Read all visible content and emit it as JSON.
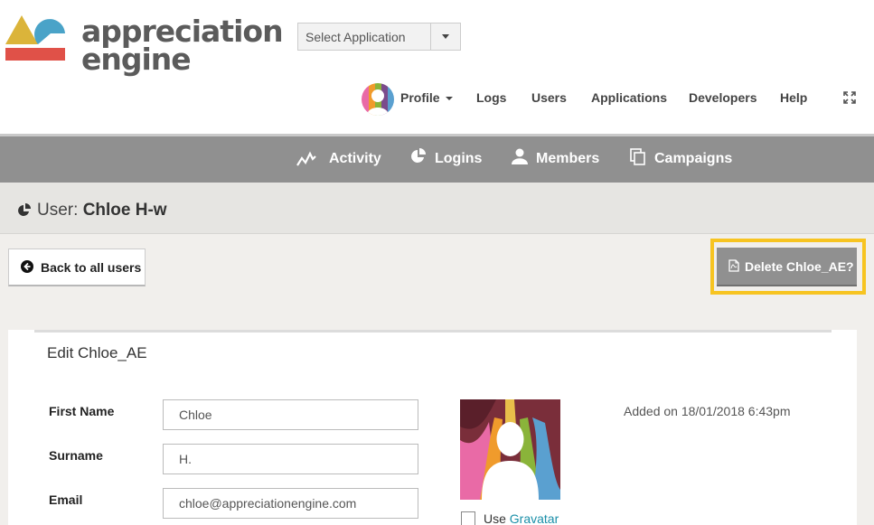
{
  "app": {
    "logo_line1": "appreciation",
    "logo_line2": "engine",
    "brand_colors": {
      "yellow": "#dbb43a",
      "blue": "#4aa3c8",
      "red": "#e05148",
      "grey": "#5b5b5b"
    }
  },
  "header": {
    "app_select": {
      "value": "Select Application"
    },
    "nav": [
      {
        "label": "Profile",
        "icon": "avatar"
      },
      {
        "label": "Logs"
      },
      {
        "label": "Users"
      },
      {
        "label": "Applications"
      },
      {
        "label": "Developers"
      },
      {
        "label": "Help"
      },
      {
        "label": "",
        "icon": "fullscreen-icon"
      }
    ]
  },
  "subnav": {
    "items": [
      {
        "label": "Activity",
        "icon": "activity-icon"
      },
      {
        "label": "Logins",
        "icon": "pie-chart-icon"
      },
      {
        "label": "Members",
        "icon": "user-icon"
      },
      {
        "label": "Campaigns",
        "icon": "copy-icon"
      }
    ]
  },
  "page": {
    "title_prefix": "User:",
    "title_name": "Chloe H-w",
    "back_label": "Back to all users",
    "delete_label": "Delete Chloe_AE?",
    "highlight_color": "#f7c421"
  },
  "form": {
    "heading": "Edit Chloe_AE",
    "fields": [
      {
        "label": "First Name",
        "value": "Chloe"
      },
      {
        "label": "Surname",
        "value": "H."
      },
      {
        "label": "Email",
        "value": "chloe@appreciationengine.com"
      }
    ],
    "gravatar_prefix": "Use",
    "gravatar_link": "Gravatar",
    "added_on": "Added on 18/01/2018 6:43pm"
  }
}
